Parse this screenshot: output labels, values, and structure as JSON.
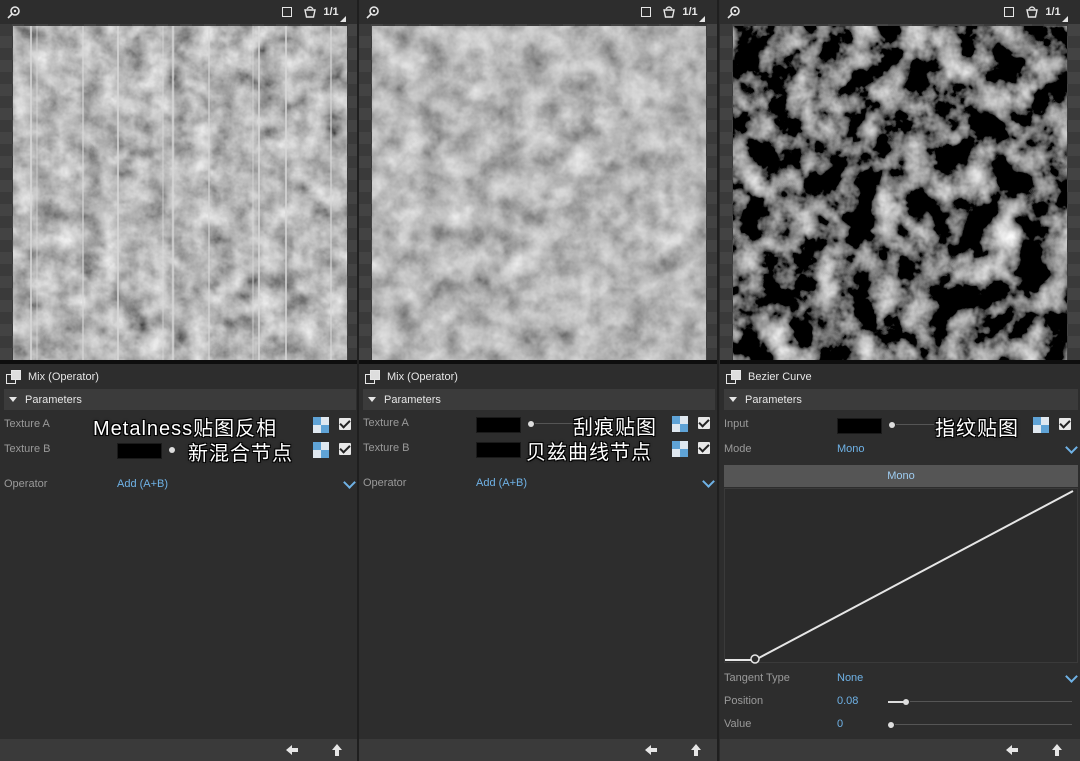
{
  "toolbar": {
    "ratio_label": "1/1"
  },
  "panels": [
    {
      "title": "Mix (Operator)",
      "section": "Parameters",
      "rows": [
        {
          "label": "Texture A"
        },
        {
          "label": "Texture B"
        }
      ],
      "operator": {
        "label": "Operator",
        "value": "Add (A+B)"
      },
      "overlay_lines": [
        "Metalness贴图反相",
        "新混合节点"
      ]
    },
    {
      "title": "Mix (Operator)",
      "section": "Parameters",
      "rows": [
        {
          "label": "Texture A"
        },
        {
          "label": "Texture B"
        }
      ],
      "operator": {
        "label": "Operator",
        "value": "Add (A+B)"
      },
      "overlay_lines": [
        "刮痕贴图",
        "贝兹曲线节点"
      ]
    },
    {
      "title": "Bezier Curve",
      "section": "Parameters",
      "input_label": "Input",
      "mode": {
        "label": "Mode",
        "value": "Mono"
      },
      "mono_bar_label": "Mono",
      "tangent": {
        "label": "Tangent Type",
        "value": "None"
      },
      "position": {
        "label": "Position",
        "value": "0.08"
      },
      "value": {
        "label": "Value",
        "value": "0"
      },
      "overlay_lines": [
        "指纹贴图"
      ]
    }
  ],
  "icons": {
    "toolbar": [
      "pin-icon",
      "square-icon",
      "pot-icon",
      "ratio-icon"
    ],
    "footer": [
      "arrow-left-icon",
      "arrow-up-icon"
    ]
  },
  "colors": {
    "accent": "#6fb2e6",
    "panel": "#2d2d2d",
    "section": "#3b3b3b"
  }
}
